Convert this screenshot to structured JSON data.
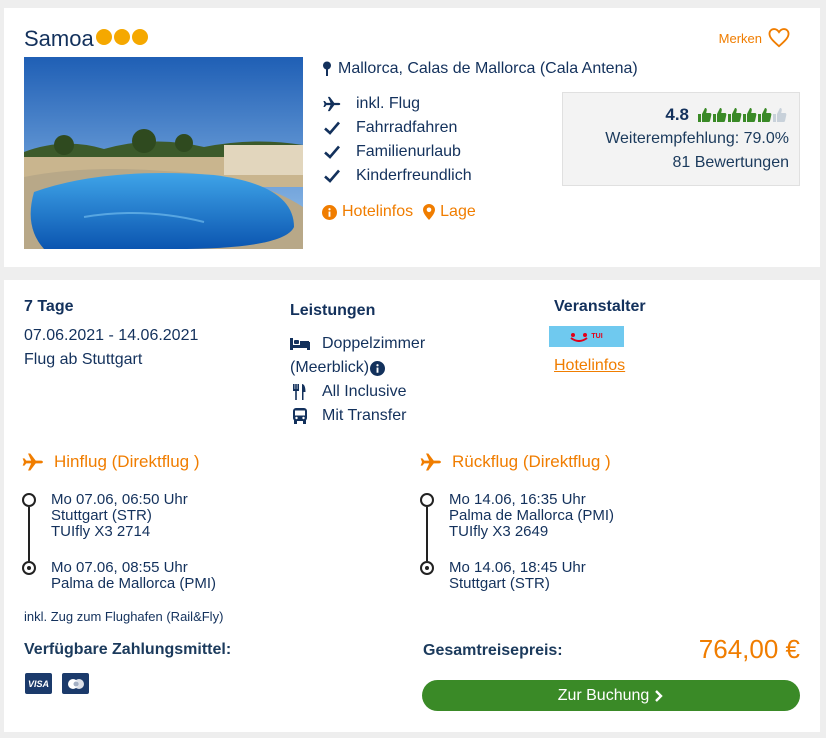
{
  "hotel": {
    "name": "Samoa",
    "stars": 3,
    "favorite_label": "Merken",
    "location": "Mallorca, Calas de Mallorca (Cala Antena)",
    "features": [
      {
        "icon": "plane-icon",
        "label": "inkl. Flug"
      },
      {
        "icon": "check-icon",
        "label": "Fahrradfahren"
      },
      {
        "icon": "check-icon",
        "label": "Familienurlaub"
      },
      {
        "icon": "check-icon",
        "label": "Kinderfreundlich"
      }
    ],
    "links": {
      "hotelinfos": "Hotelinfos",
      "lage": "Lage"
    },
    "rating": {
      "score": "4.8",
      "thumbs_filled": 5,
      "thumbs_total": 6,
      "recommendation": "Weiterempfehlung: 79.0%",
      "reviews": "81 Bewertungen"
    },
    "colors": {
      "accent": "#f07d00",
      "text": "#13315c",
      "button": "#3a8a27",
      "stars": "#f5a800"
    }
  },
  "offer": {
    "duration": "7 Tage",
    "dates": "07.06.2021 - 14.06.2021",
    "departure": "Flug ab Stuttgart",
    "services_title": "Leistungen",
    "services": {
      "room_line1": "Doppelzimmer",
      "room_line2": "(Meerblick)",
      "board": "All Inclusive",
      "transfer": "Mit Transfer"
    },
    "operator_title": "Veranstalter",
    "operator_logo": "TUI",
    "operator_link": "Hotelinfos",
    "outbound": {
      "title": "Hinflug (Direktflug )",
      "dep_time": "Mo 07.06, 06:50 Uhr",
      "dep_airport": "Stuttgart (STR)",
      "flight": "TUIfly X3 2714",
      "arr_time": "Mo 07.06, 08:55 Uhr",
      "arr_airport": "Palma de Mallorca (PMI)"
    },
    "return": {
      "title": "Rückflug (Direktflug )",
      "dep_time": "Mo 14.06, 16:35 Uhr",
      "dep_airport": "Palma de Mallorca (PMI)",
      "flight": "TUIfly X3 2649",
      "arr_time": "Mo 14.06, 18:45 Uhr",
      "arr_airport": "Stuttgart (STR)"
    },
    "rail_note": "inkl. Zug zum Flughafen (Rail&Fly)",
    "payment_title": "Verfügbare Zahlungsmittel:",
    "payment_methods": [
      "VISA",
      "Mastercard"
    ],
    "total_label": "Gesamtreisepreis:",
    "total_price": "764,00 €",
    "book_label": "Zur Buchung"
  }
}
